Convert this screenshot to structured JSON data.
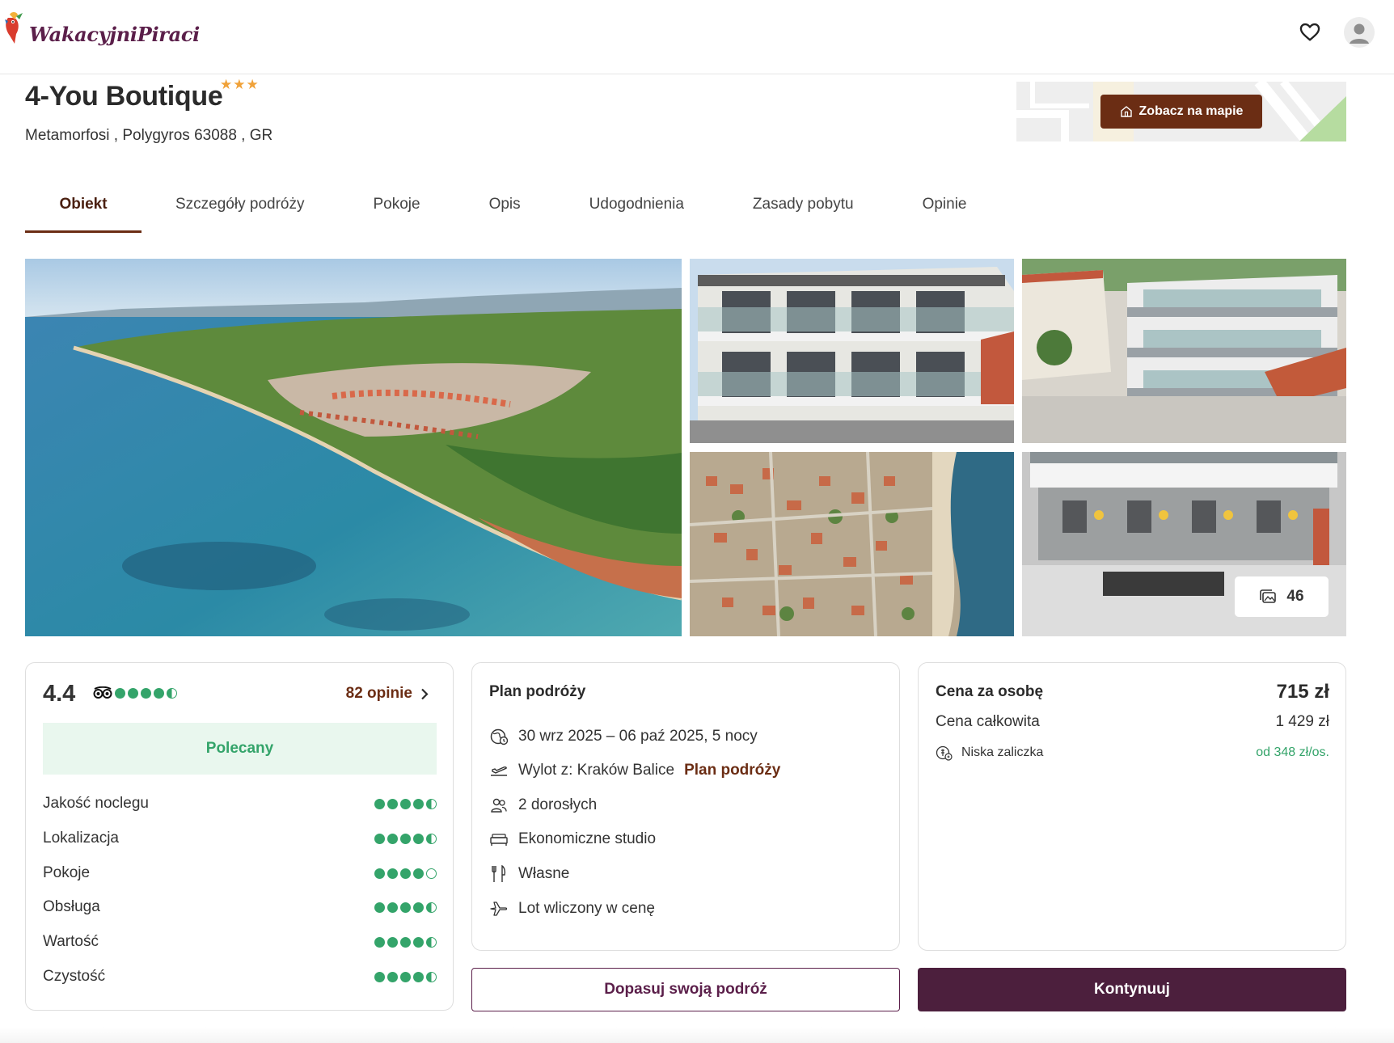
{
  "header": {
    "logo_text": "WakacyjniPiraci",
    "favorites_icon": "heart-icon",
    "account_icon": "user-avatar-icon"
  },
  "hotel": {
    "name": "4-You Boutique",
    "stars": "★★★",
    "star_count": 3,
    "address": "Metamorfosi , Polygyros 63088 , GR"
  },
  "map": {
    "button_label": "Zobacz na mapie"
  },
  "tabs": [
    {
      "label": "Obiekt",
      "active": true
    },
    {
      "label": "Szczegóły podróży",
      "active": false
    },
    {
      "label": "Pokoje",
      "active": false
    },
    {
      "label": "Opis",
      "active": false
    },
    {
      "label": "Udogodnienia",
      "active": false
    },
    {
      "label": "Zasady pobytu",
      "active": false
    },
    {
      "label": "Opinie",
      "active": false
    }
  ],
  "gallery": {
    "photo_count": "46"
  },
  "ratings": {
    "score": "4.4",
    "score_bubbles": 4.5,
    "reviews_link": "82 opinie",
    "recommendation": "Polecany",
    "categories": [
      {
        "label": "Jakość noclegu",
        "bubbles": 4.5
      },
      {
        "label": "Lokalizacja",
        "bubbles": 4.5
      },
      {
        "label": "Pokoje",
        "bubbles": 4
      },
      {
        "label": "Obsługa",
        "bubbles": 4.5
      },
      {
        "label": "Wartość",
        "bubbles": 4.5
      },
      {
        "label": "Czystość",
        "bubbles": 4.5
      }
    ]
  },
  "plan": {
    "title": "Plan podróży",
    "dates": "30 wrz 2025 – 06 paź 2025, 5 nocy",
    "departure": "Wylot z: Kraków Balice",
    "departure_link": "Plan podróży",
    "travelers": "2 dorosłych",
    "room": "Ekonomiczne studio",
    "board": "Własne",
    "flight": "Lot wliczony w cenę"
  },
  "price": {
    "per_person_label": "Cena za osobę",
    "per_person_value": "715 zł",
    "total_label": "Cena całkowita",
    "total_value": "1 429 zł",
    "deposit_label": "Niska zaliczka",
    "deposit_value": "od 348 zł/os."
  },
  "actions": {
    "customize_label": "Dopasuj swoją podróż",
    "continue_label": "Kontynuuj"
  },
  "colors": {
    "brand": "#5b1f4a",
    "accent": "#6b2d14",
    "rating_green": "#34a46a",
    "star": "#f0a23a"
  }
}
